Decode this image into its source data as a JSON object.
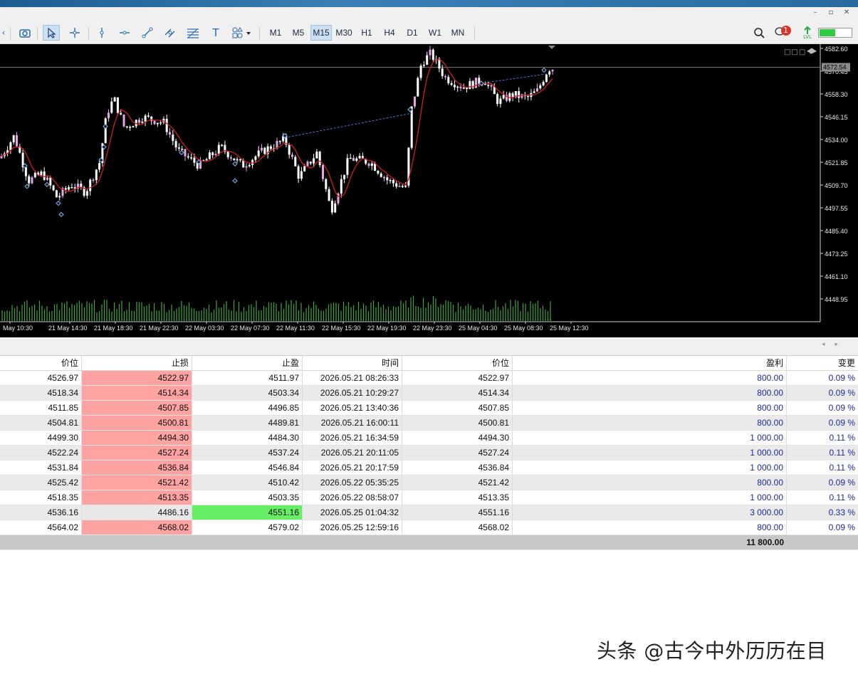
{
  "toolbar": {
    "timeframes": [
      "M1",
      "M5",
      "M15",
      "M30",
      "H1",
      "H4",
      "D1",
      "W1",
      "MN"
    ],
    "selected_timeframe": "M15",
    "notification_count": "1",
    "lvl_label": "LVL"
  },
  "chart": {
    "corner_label": "□□□",
    "current_price": "4572.54",
    "price_axis": [
      "4582.60",
      "4570.45",
      "4558.30",
      "4546.15",
      "4534.00",
      "4521.85",
      "4509.70",
      "4497.55",
      "4485.40",
      "4473.25",
      "4461.10",
      "4448.95"
    ],
    "time_axis": [
      "May 10:30",
      "21 May 14:30",
      "21 May 18:30",
      "21 May 22:30",
      "22 May 03:30",
      "22 May 07:30",
      "22 May 11:30",
      "22 May 15:30",
      "22 May 19:30",
      "22 May 23:30",
      "25 May 04:30",
      "25 May 08:30",
      "25 May 12:30"
    ],
    "colors": {
      "background": "#000000",
      "candle_body": "#ffffff",
      "candle_alt": "#e6a6e6",
      "ma_line": "#cc1f1f",
      "volume": "#3ea83e",
      "trend_line": "#5a7fe0"
    }
  },
  "table": {
    "headers": [
      "价位",
      "止损",
      "止盈",
      "时间",
      "价位",
      "盈利",
      "变更"
    ],
    "rows": [
      [
        "4526.97",
        "4522.97",
        "4511.97",
        "2026.05.21 08:26:33",
        "4522.97",
        "800.00",
        "0.09 %"
      ],
      [
        "4518.34",
        "4514.34",
        "4503.34",
        "2026.05.21 10:29:27",
        "4514.34",
        "800.00",
        "0.09 %"
      ],
      [
        "4511.85",
        "4507.85",
        "4496.85",
        "2026.05.21 13:40:36",
        "4507.85",
        "800.00",
        "0.09 %"
      ],
      [
        "4504.81",
        "4500.81",
        "4489.81",
        "2026.05.21 16:00:11",
        "4500.81",
        "800.00",
        "0.09 %"
      ],
      [
        "4499.30",
        "4494.30",
        "4484.30",
        "2026.05.21 16:34:59",
        "4494.30",
        "1 000.00",
        "0.11 %"
      ],
      [
        "4522.24",
        "4527.24",
        "4537.24",
        "2026.05.21 20:11:05",
        "4527.24",
        "1 000.00",
        "0.11 %"
      ],
      [
        "4531.84",
        "4536.84",
        "4546.84",
        "2026.05.21 20:17:59",
        "4536.84",
        "1 000.00",
        "0.11 %"
      ],
      [
        "4525.42",
        "4521.42",
        "4510.42",
        "2026.05.22 05:35:25",
        "4521.42",
        "800.00",
        "0.09 %"
      ],
      [
        "4518.35",
        "4513.35",
        "4503.35",
        "2026.05.22 08:58:07",
        "4513.35",
        "1 000.00",
        "0.11 %"
      ],
      [
        "4536.16",
        "4486.16",
        "4551.16",
        "2026.05.25 01:04:32",
        "4551.16",
        "3 000.00",
        "0.33 %"
      ],
      [
        "4564.02",
        "4568.02",
        "4579.02",
        "2026.05.25 12:59:16",
        "4568.02",
        "800.00",
        "0.09 %"
      ]
    ],
    "highlight": [
      "red",
      "red",
      "red",
      "red",
      "red",
      "red",
      "red",
      "red",
      "red",
      "green",
      "red"
    ],
    "total_profit": "11 800.00"
  },
  "watermark": "头条 @古今中外历历在目"
}
